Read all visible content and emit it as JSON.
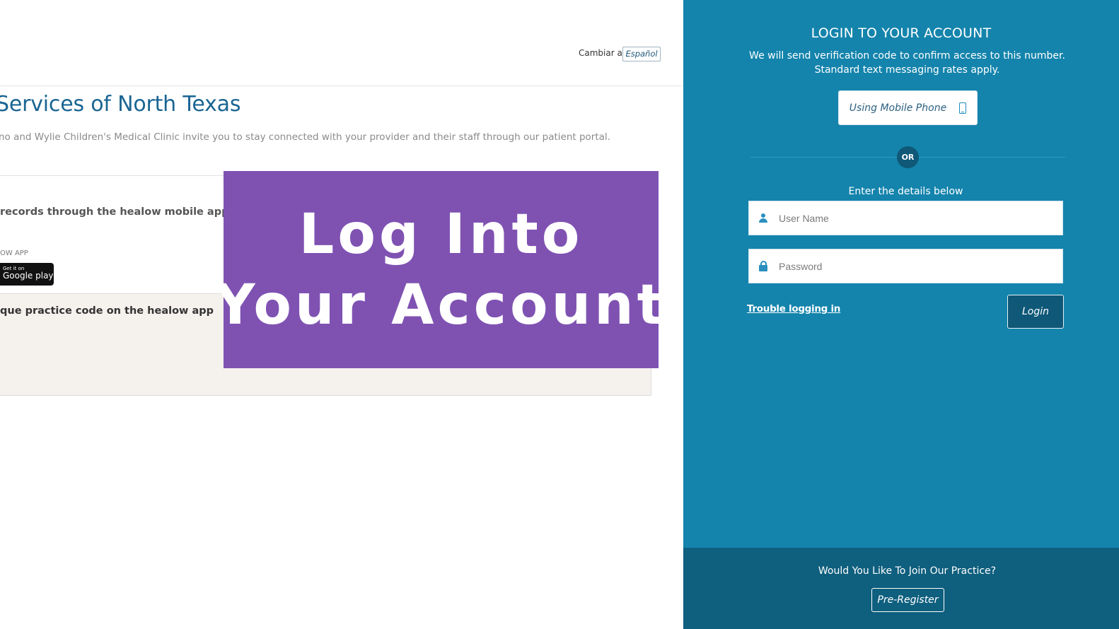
{
  "portal": {
    "language_switch_label": "Cambiar a",
    "language_button": "Español",
    "practice_title": "Services of North Texas",
    "practice_description": "no and Wylie Children's Medical Clinic invite you to stay connected with your provider and their staff through our patient portal.",
    "app_heading": "records through the healow mobile app",
    "app_label": "OW APP",
    "google_play": {
      "small": "Get it on",
      "big": "Google play"
    },
    "code_heading": "que practice code on the healow app"
  },
  "banner": {
    "line1": "Log Into",
    "line2": "Your Account",
    "color": "#7f52b2"
  },
  "login": {
    "title": "LOGIN TO YOUR ACCOUNT",
    "verify_line1": "We will send verification code to confirm access to this number.",
    "verify_line2": "Standard text messaging rates apply.",
    "mobile_button": "Using Mobile Phone",
    "mobile_icon": "mobile-phone-icon",
    "or_label": "OR",
    "details_label": "Enter the details below",
    "username_placeholder": "User Name",
    "username_icon": "user-icon",
    "password_placeholder": "Password",
    "password_icon": "lock-icon",
    "trouble_link": "Trouble logging in",
    "login_button": "Login",
    "panel_color": "#1484ac"
  },
  "footer": {
    "join_text": "Would You Like To Join Our Practice?",
    "preregister_button": "Pre-Register",
    "color": "#0f5f7e"
  }
}
